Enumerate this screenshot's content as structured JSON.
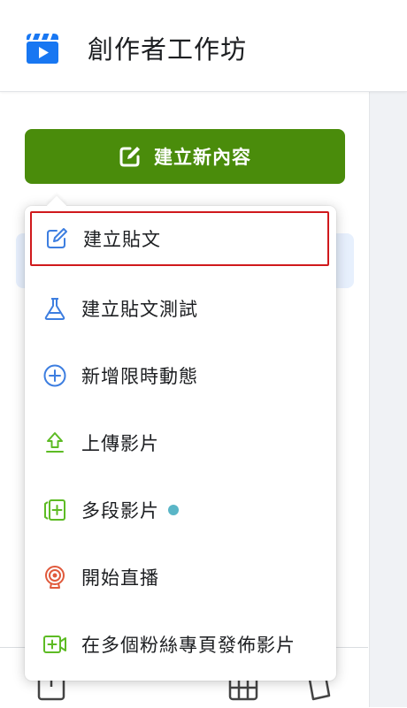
{
  "header": {
    "title": "創作者工作坊",
    "icon": "clapperboard-play-icon",
    "icon_color": "#1877f2"
  },
  "create_button": {
    "label": "建立新內容",
    "icon": "edit-square-icon",
    "color": "#4a8c0b"
  },
  "menu": {
    "items": [
      {
        "label": "建立貼文",
        "icon": "pencil-square-icon",
        "selected": true
      },
      {
        "label": "建立貼文測試",
        "icon": "flask-icon"
      },
      {
        "label": "新增限時動態",
        "icon": "plus-circle-icon"
      },
      {
        "label": "上傳影片",
        "icon": "upload-arrow-icon"
      },
      {
        "label": "多段影片",
        "icon": "multi-clip-video-icon",
        "badge": "new-dot"
      },
      {
        "label": "開始直播",
        "icon": "live-broadcast-icon"
      },
      {
        "label": "在多個粉絲專頁發佈影片",
        "icon": "video-camera-plus-icon"
      }
    ],
    "highlight_color": "#d0191c"
  }
}
